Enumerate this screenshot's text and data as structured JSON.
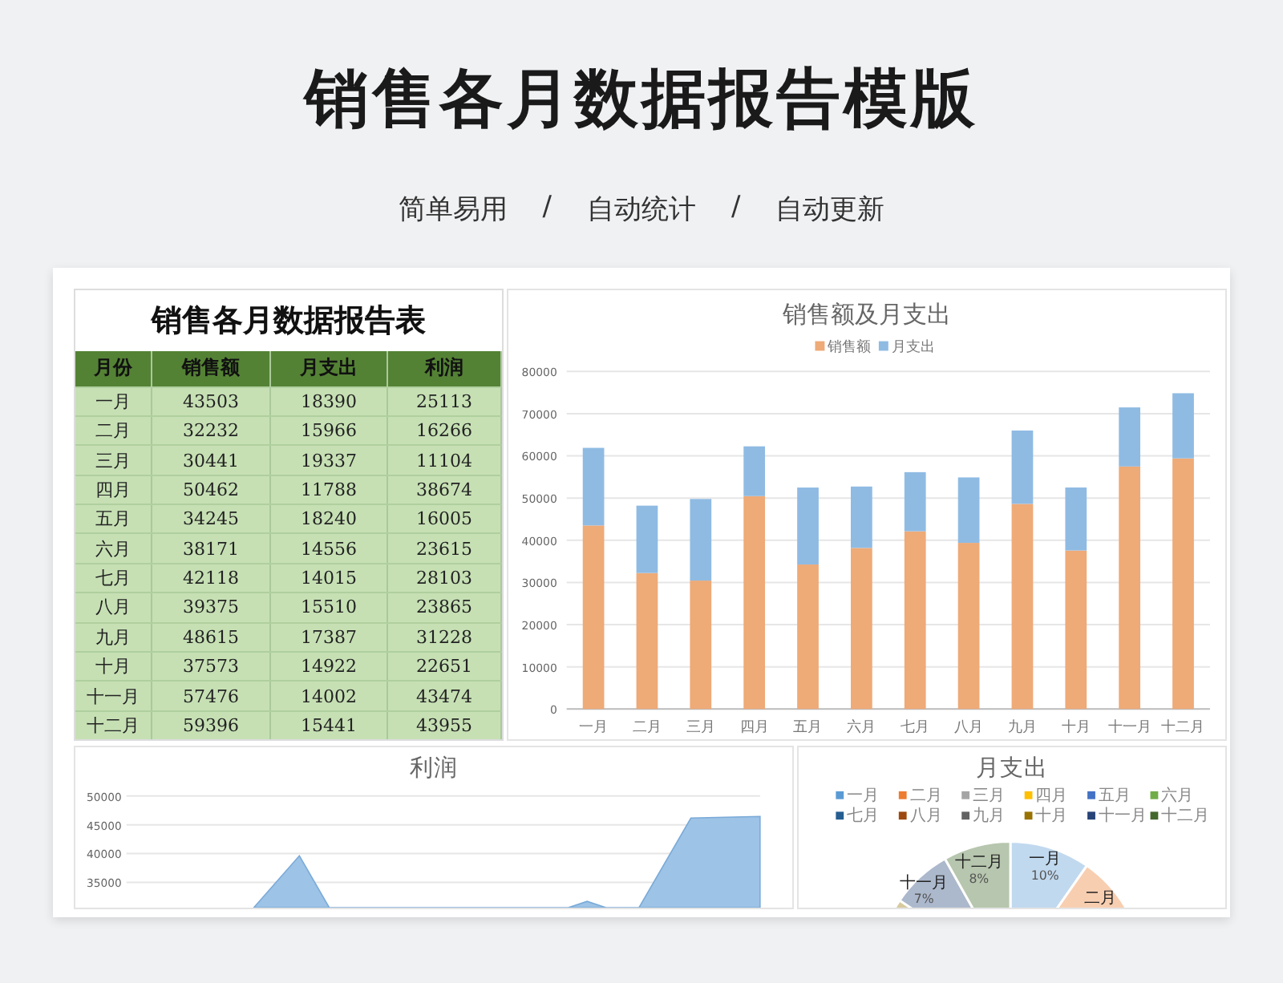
{
  "header": {
    "title": "销售各月数据报告模版",
    "tagline": [
      "简单易用",
      "/",
      "自动统计",
      "/",
      "自动更新"
    ]
  },
  "table": {
    "title": "销售各月数据报告表",
    "columns": [
      "月份",
      "销售额",
      "月支出",
      "利润"
    ],
    "rows": [
      [
        "一月",
        "43503",
        "18390",
        "25113"
      ],
      [
        "二月",
        "32232",
        "15966",
        "16266"
      ],
      [
        "三月",
        "30441",
        "19337",
        "11104"
      ],
      [
        "四月",
        "50462",
        "11788",
        "38674"
      ],
      [
        "五月",
        "34245",
        "18240",
        "16005"
      ],
      [
        "六月",
        "38171",
        "14556",
        "23615"
      ],
      [
        "七月",
        "42118",
        "14015",
        "28103"
      ],
      [
        "八月",
        "39375",
        "15510",
        "23865"
      ],
      [
        "九月",
        "48615",
        "17387",
        "31228"
      ],
      [
        "十月",
        "37573",
        "14922",
        "22651"
      ],
      [
        "十一月",
        "57476",
        "14002",
        "43474"
      ],
      [
        "十二月",
        "59396",
        "15441",
        "43955"
      ]
    ]
  },
  "sales_chart": {
    "chart_data": {
      "type": "bar",
      "title": "销售额及月支出",
      "legend": "top",
      "grid": true,
      "categories": [
        "一月",
        "二月",
        "三月",
        "四月",
        "五月",
        "六月",
        "七月",
        "八月",
        "九月",
        "十月",
        "十一月",
        "十二月"
      ],
      "stacked": true,
      "ylim": [
        0,
        80000
      ],
      "yticks": [
        0,
        10000,
        20000,
        30000,
        40000,
        50000,
        60000,
        70000,
        80000
      ],
      "series": [
        {
          "name": "销售额",
          "color": "#eeaa77",
          "values": [
            43503,
            32232,
            30441,
            50462,
            34245,
            38171,
            42118,
            39375,
            48615,
            37573,
            57476,
            59396
          ]
        },
        {
          "name": "月支出",
          "color": "#8fbbe3",
          "values": [
            18390,
            15966,
            19337,
            11788,
            18240,
            14556,
            14015,
            15510,
            17387,
            14922,
            14002,
            15441
          ]
        }
      ]
    }
  },
  "profit_chart": {
    "title": "利润",
    "axis_labels": [
      "50000",
      "45000",
      "40000",
      "35000"
    ]
  },
  "expense_chart": {
    "legend": [
      {
        "label": "一月",
        "color": "#5b9bd5"
      },
      {
        "label": "二月",
        "color": "#ed7d31"
      },
      {
        "label": "三月",
        "color": "#a5a5a5"
      },
      {
        "label": "四月",
        "color": "#ffc000"
      },
      {
        "label": "五月",
        "color": "#4472c4"
      },
      {
        "label": "六月",
        "color": "#70ad47"
      },
      {
        "label": "七月",
        "color": "#255e91"
      },
      {
        "label": "八月",
        "color": "#9e480e"
      },
      {
        "label": "九月",
        "color": "#636363"
      },
      {
        "label": "十月",
        "color": "#997300"
      },
      {
        "label": "十一月",
        "color": "#264478"
      },
      {
        "label": "十二月",
        "color": "#43682b"
      }
    ],
    "title": "月支出",
    "slice_labels": [
      {
        "label": "十一月",
        "percent": "7%"
      },
      {
        "label": "十二月",
        "percent": "8%"
      },
      {
        "label": "一月",
        "percent": "10%"
      },
      {
        "label": "二月"
      }
    ]
  }
}
